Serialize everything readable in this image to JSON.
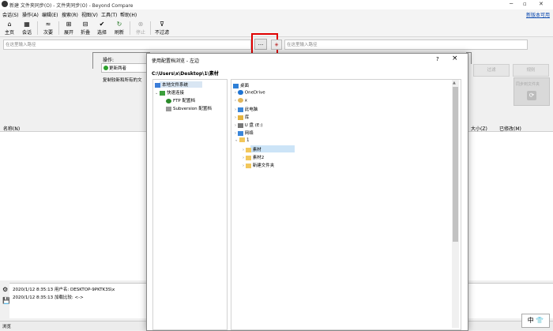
{
  "window": {
    "title": "新建 文件夹同步(O) - 文件夹同步(O) - Beyond Compare"
  },
  "menu": {
    "items": [
      "会话(S)",
      "操作(A)",
      "编辑(E)",
      "搜索(R)",
      "视图(V)",
      "工具(T)",
      "帮助(H)"
    ],
    "new_version": "新版本可用"
  },
  "toolbar": {
    "items": [
      "主页",
      "会话",
      "次要",
      "展开",
      "折叠",
      "选择",
      "刷新",
      "停止",
      "不过滤"
    ]
  },
  "paths": {
    "left_placeholder": "在这里输入路径",
    "right_placeholder": "在这里输入路径",
    "browse_label": "..."
  },
  "operation": {
    "label": "操作:",
    "value": "更新两者",
    "description": "复制较新和所有的文"
  },
  "buttons": {
    "filter": "过滤",
    "rules": "规则",
    "sync": "同步到文件夹"
  },
  "columns": {
    "name": "名称(N)",
    "size": "大小(Z)",
    "modified": "已修改(M)"
  },
  "log": {
    "lines": [
      "2020/1/12 8:35:13  用户名: DESKTOP-9PKTK3S\\x",
      "2020/1/12 8:35:13  加载比较: <->"
    ]
  },
  "status": {
    "text": "浏览"
  },
  "ime": {
    "label": "中"
  },
  "dialog": {
    "title": "使用配置档浏览 - 左边",
    "help": "?",
    "close": "×",
    "current_path": "C:\\Users\\x\\Desktop\\1\\素材",
    "tree": [
      "本地文件系统",
      "快速连接",
      "FTP 配置档",
      "Subversion 配置档"
    ],
    "folders": [
      "桌面",
      "OneDrive",
      "x",
      "此电脑",
      "库",
      "U 盘 (E:)",
      "网络",
      "1",
      "素材",
      "素材2",
      "新建文件夹"
    ]
  }
}
